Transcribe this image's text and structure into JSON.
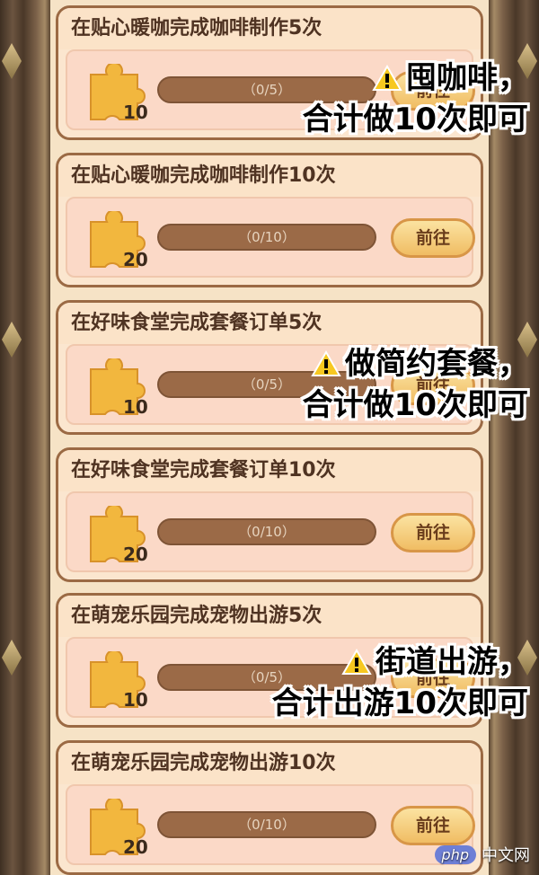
{
  "tasks": [
    {
      "title": "在贴心暖咖完成咖啡制作5次",
      "reward": "10",
      "progress_text": "（0/5）",
      "button": "前往",
      "progress": 0
    },
    {
      "title": "在贴心暖咖完成咖啡制作10次",
      "reward": "20",
      "progress_text": "（0/10）",
      "button": "前往",
      "progress": 0
    },
    {
      "title": "在好味食堂完成套餐订单5次",
      "reward": "10",
      "progress_text": "（0/5）",
      "button": "前往",
      "progress": 0
    },
    {
      "title": "在好味食堂完成套餐订单10次",
      "reward": "20",
      "progress_text": "（0/10）",
      "button": "前往",
      "progress": 0
    },
    {
      "title": "在萌宠乐园完成宠物出游5次",
      "reward": "10",
      "progress_text": "（0/5）",
      "button": "前往",
      "progress": 0
    },
    {
      "title": "在萌宠乐园完成宠物出游10次",
      "reward": "20",
      "progress_text": "（0/10）",
      "button": "前往",
      "progress": 0
    }
  ],
  "annotations": [
    {
      "line1": "囤咖啡，",
      "line2": "合计做10次即可"
    },
    {
      "line1": "做简约套餐，",
      "line2": "合计做10次即可"
    },
    {
      "line1": "街道出游，",
      "line2": "合计出游10次即可"
    }
  ],
  "watermark": {
    "logo": "php",
    "text": "中文网"
  },
  "colors": {
    "accent": "#f0bd63",
    "card_border": "#9b6a44",
    "bar": "#9b6a47",
    "title_text": "#4f3322"
  },
  "icons": {
    "reward": "puzzle-piece-icon",
    "warning": "warning-icon"
  }
}
